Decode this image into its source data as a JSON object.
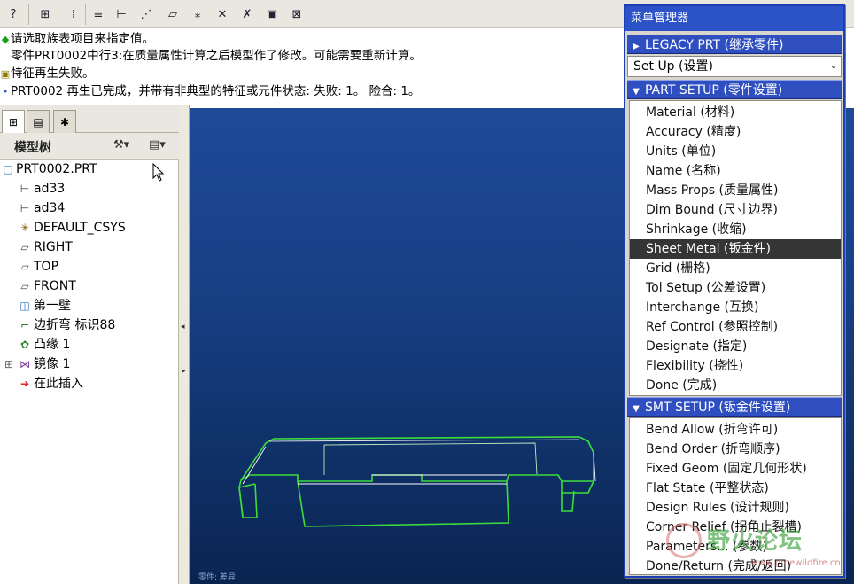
{
  "toolbar": {
    "icons": [
      "help-icon",
      "sketch-icon",
      "datum-icon",
      "filter-icon",
      "tree-icon",
      "axis-icon",
      "plane-icon",
      "point-icon",
      "csys-icon",
      "csys-off-icon",
      "window-icon",
      "close-icon"
    ]
  },
  "messages": [
    {
      "icon": "◆",
      "text": "请选取族表项目来指定值。"
    },
    {
      "icon": "",
      "text": "零件PRT0002中行3:在质量属性计算之后模型作了修改。可能需要重新计算。"
    },
    {
      "icon": "▣",
      "text": "特征再生失败。"
    },
    {
      "icon": "•",
      "text": "PRT0002 再生已完成，并带有非典型的特征或元件状态: 失败: 1。 险合: 1。"
    }
  ],
  "left_panel": {
    "title": "模型树",
    "tree": [
      {
        "label": "PRT0002.PRT",
        "icon": "part-icon"
      },
      {
        "label": "ad33",
        "icon": "dimension-icon"
      },
      {
        "label": "ad34",
        "icon": "dimension-icon"
      },
      {
        "label": "DEFAULT_CSYS",
        "icon": "csys-icon"
      },
      {
        "label": "RIGHT",
        "icon": "plane-icon"
      },
      {
        "label": "TOP",
        "icon": "plane-icon"
      },
      {
        "label": "FRONT",
        "icon": "plane-icon"
      },
      {
        "label": "第一壁",
        "icon": "wall-icon"
      },
      {
        "label": "边折弯 标识88",
        "icon": "bend-icon"
      },
      {
        "label": "凸缘 1",
        "icon": "flange-icon"
      },
      {
        "label": "镜像 1",
        "icon": "mirror-icon"
      },
      {
        "label": "在此插入",
        "icon": "insert-arrow-icon"
      }
    ]
  },
  "viewport": {
    "caption": "零件: 差异"
  },
  "menu": {
    "title": "菜单管理器",
    "legacy": "LEGACY PRT (继承零件)",
    "setup_select": "Set Up (设置)",
    "part_setup_header": "PART SETUP (零件设置)",
    "part_setup_items": [
      "Material (材料)",
      "Accuracy (精度)",
      "Units (单位)",
      "Name (名称)",
      "Mass Props (质量属性)",
      "Dim Bound (尺寸边界)",
      "Shrinkage (收缩)",
      "Sheet Metal (钣金件)",
      "Grid (栅格)",
      "Tol Setup (公差设置)",
      "Interchange (互换)",
      "Ref Control (参照控制)",
      "Designate (指定)",
      "Flexibility (挠性)",
      "Done (完成)"
    ],
    "selected_item": "Sheet Metal (钣金件)",
    "smt_setup_header": "SMT SETUP (钣金件设置)",
    "smt_setup_items": [
      "Bend Allow (折弯许可)",
      "Bend Order (折弯顺序)",
      "Fixed Geom (固定几何形状)",
      "Flat State (平整状态)",
      "Design Rules (设计规则)",
      "Corner Relief (拐角止裂槽)",
      "Parameters... (参数)",
      "Done/Return (完成/返回)"
    ]
  },
  "watermark": {
    "text": "野火论坛",
    "url": "www.proewildfire.cn"
  },
  "colors": {
    "menu_header": "#2f4fc0",
    "selection": "#353535",
    "model_edges": "#3ddc3d",
    "viewport_top": "#1e4a98",
    "viewport_bottom": "#0a2451"
  }
}
